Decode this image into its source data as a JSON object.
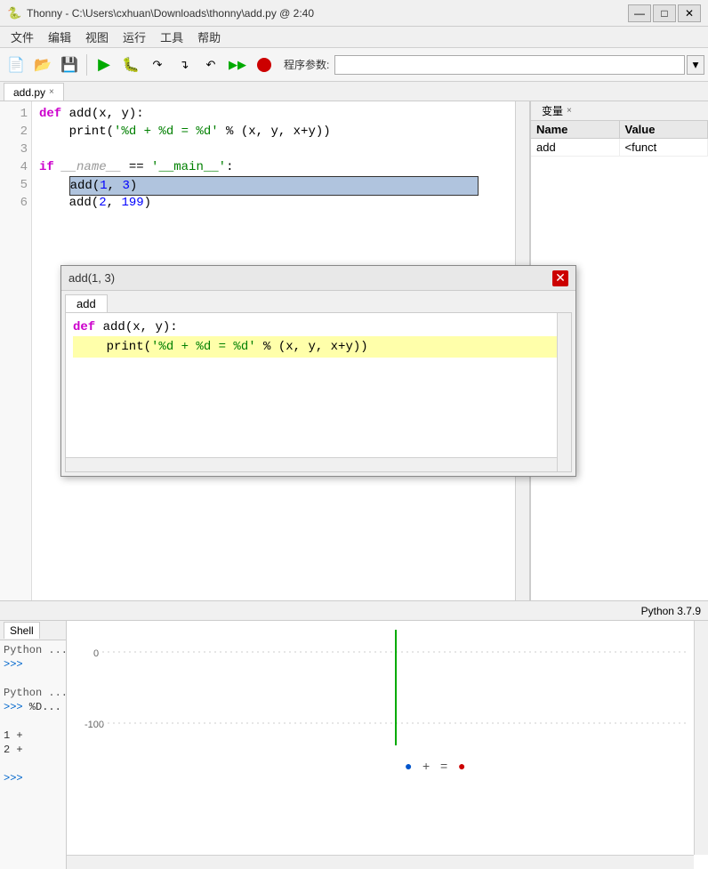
{
  "titleBar": {
    "icon": "🐍",
    "title": "Thonny - C:\\Users\\cxhuan\\Downloads\\thonny\\add.py @ 2:40",
    "minimize": "—",
    "maximize": "□",
    "close": "✕"
  },
  "menuBar": {
    "items": [
      "文件",
      "编辑",
      "视图",
      "运行",
      "工具",
      "帮助"
    ]
  },
  "toolbar": {
    "programArgsLabel": "程序参数:",
    "programArgsPlaceholder": ""
  },
  "editorTab": {
    "label": "add.py",
    "closeSymbol": "×"
  },
  "codeLines": [
    {
      "num": 1,
      "text": "def add(x, y):"
    },
    {
      "num": 2,
      "text": "    print('%d + %d = %d' % (x, y, x+y))"
    },
    {
      "num": 3,
      "text": ""
    },
    {
      "num": 4,
      "text": "if __name__ == '__main__':"
    },
    {
      "num": 5,
      "text": "    add(1, 3)"
    },
    {
      "num": 6,
      "text": "    add(2, 199)"
    }
  ],
  "variablesPane": {
    "tabLabel": "变量",
    "closeSymbol": "×",
    "headers": [
      "Name",
      "Value"
    ],
    "rows": [
      {
        "name": "add",
        "value": "<funct"
      }
    ]
  },
  "shellPane": {
    "tabLabel": "Shell",
    "lines": [
      {
        "text": "Python ...",
        "type": "output"
      },
      {
        "text": ">>>",
        "type": "prompt"
      },
      {
        "text": "",
        "type": "blank"
      },
      {
        "text": "Python ...",
        "type": "output"
      },
      {
        "text": ">>> %D...",
        "type": "prompt"
      },
      {
        "text": "",
        "type": "blank"
      },
      {
        "text": "1 +",
        "type": "output"
      },
      {
        "text": "2 +",
        "type": "output"
      },
      {
        "text": "",
        "type": "blank"
      },
      {
        "text": ">>>",
        "type": "prompt"
      }
    ]
  },
  "chartPane": {
    "yLabels": [
      "0",
      "-100"
    ],
    "dots": [
      "●",
      "+",
      "=",
      "●"
    ]
  },
  "debugDialog": {
    "title": "add(1, 3)",
    "closeBtn": "✕",
    "tabLabel": "add",
    "codeLine1": "def add(x, y):",
    "codeLine2": "    print('%d + %d = %d' % (x, y, x+y))"
  },
  "statusBar": {
    "pythonVersion": "Python 3.7.9"
  }
}
